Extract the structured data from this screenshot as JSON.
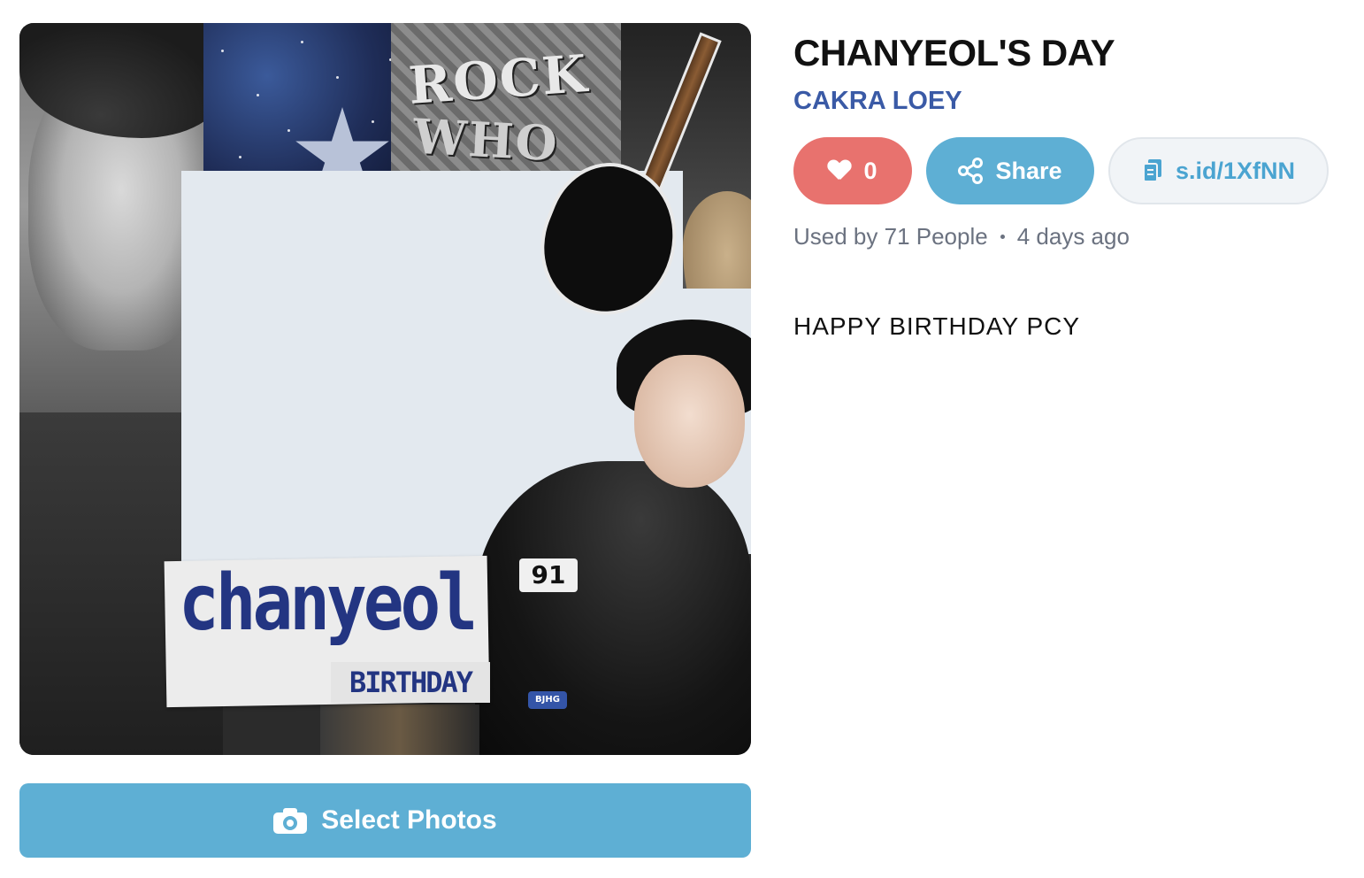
{
  "frame": {
    "label_name": "chanyeol",
    "label_sub": "BIRTHDAY",
    "collage_text_1": "ROCK",
    "collage_text_2": "WHO",
    "patch_number": "91",
    "patch_small": "BJHG"
  },
  "actions": {
    "select_photos_label": "Select Photos"
  },
  "info": {
    "title": "CHANYEOL'S DAY",
    "author": "CAKRA LOEY",
    "like_count": "0",
    "share_label": "Share",
    "short_link": "s.id/1XfNN",
    "used_by": "Used by 71 People",
    "time_ago": "4 days ago",
    "description": "HAPPY BIRTHDAY PCY"
  },
  "colors": {
    "like": "#e8726e",
    "share": "#5eafd4",
    "author": "#3a5aa6",
    "link_text": "#4ba4d1",
    "frame_blank": "#e3e9ef",
    "label_ink": "#233582"
  },
  "icons": {
    "like": "heart-icon",
    "share": "share-icon",
    "link": "copy-icon",
    "select": "camera-icon"
  }
}
